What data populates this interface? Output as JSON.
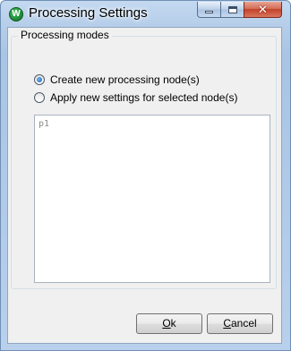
{
  "window": {
    "title": "Processing Settings",
    "app_icon_letter": "W",
    "controls": {
      "minimize": "minimize",
      "maximize": "maximize",
      "close": "✕"
    }
  },
  "group": {
    "legend": "Processing modes",
    "options": [
      {
        "label": "Create new processing node(s)",
        "checked": true
      },
      {
        "label": "Apply new settings for selected node(s)",
        "checked": false
      }
    ]
  },
  "editor": {
    "text": "p1"
  },
  "buttons": {
    "ok": {
      "mnemonic": "O",
      "rest": "k"
    },
    "cancel": {
      "mnemonic": "C",
      "rest": "ancel"
    }
  },
  "colors": {
    "accent": "#1b5fa8",
    "close": "#c2412a"
  }
}
